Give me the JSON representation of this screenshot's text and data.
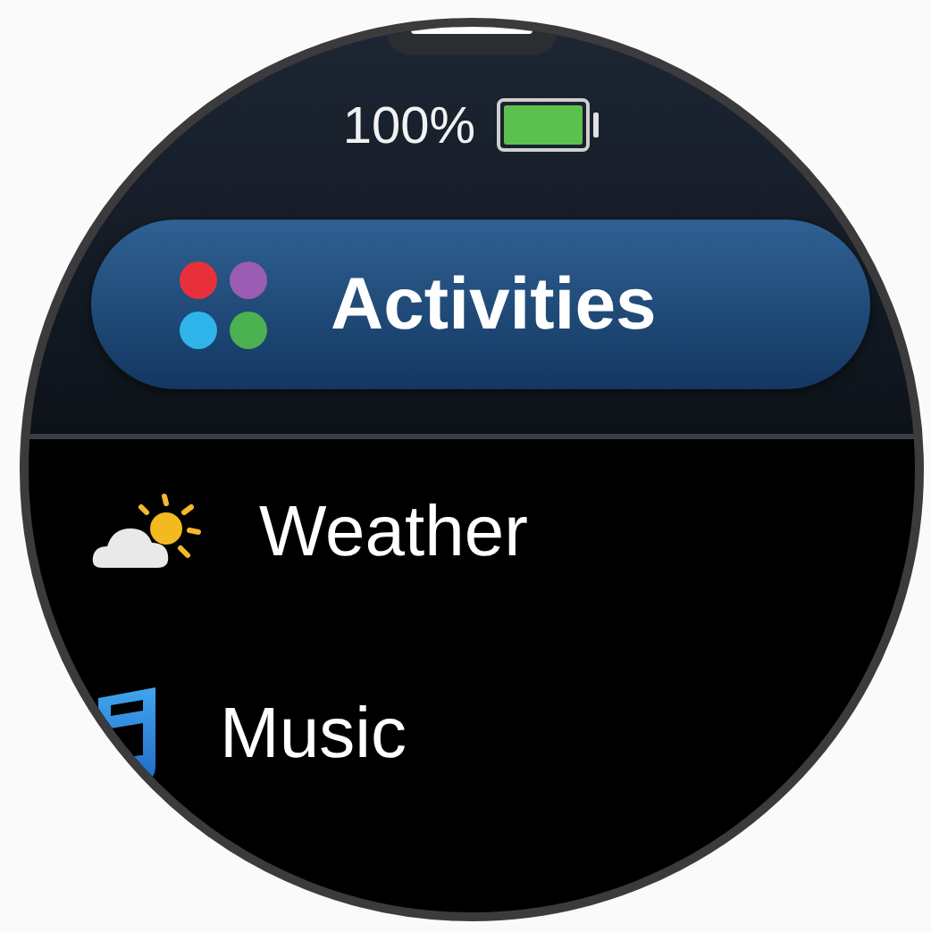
{
  "status": {
    "battery_text": "100%"
  },
  "menu_items": [
    {
      "label": "Activities",
      "selected": true
    },
    {
      "label": "Weather",
      "selected": false
    },
    {
      "label": "Music",
      "selected": false
    }
  ]
}
